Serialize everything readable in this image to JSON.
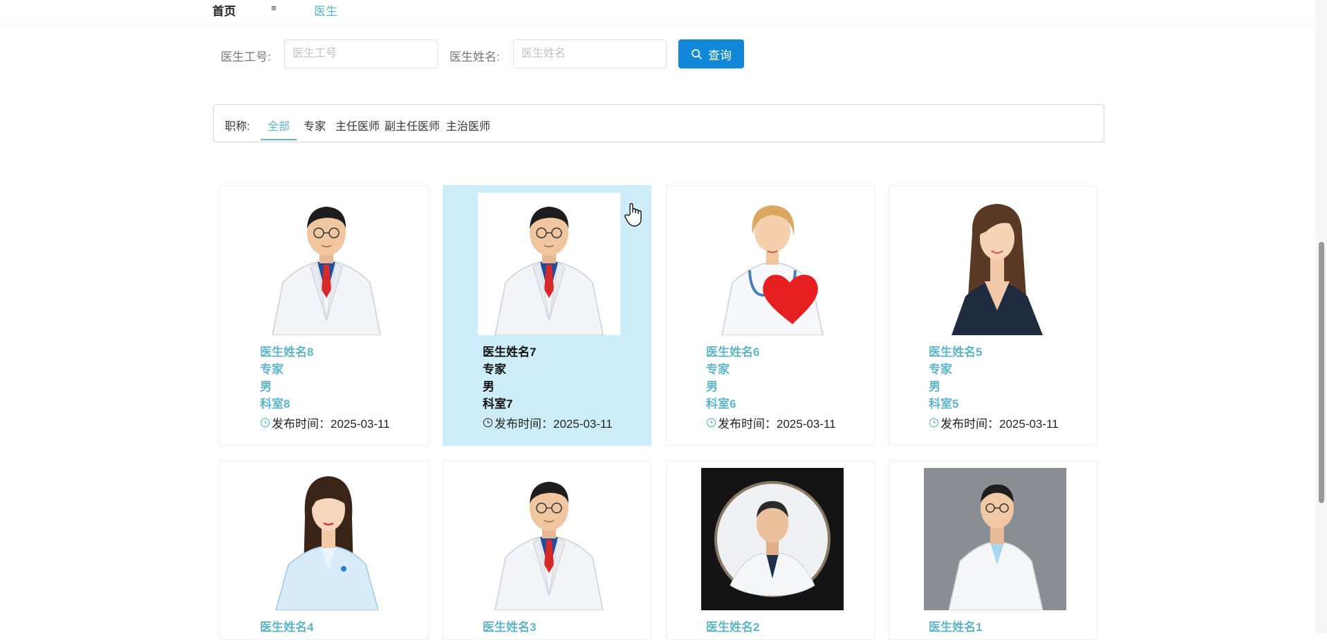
{
  "nav": {
    "home": "首页",
    "menu_glyph": "≡",
    "doctor": "医生"
  },
  "search": {
    "id_label": "医生工号:",
    "id_placeholder": "医生工号",
    "name_label": "医生姓名:",
    "name_placeholder": "医生姓名",
    "button_label": "查询"
  },
  "filter": {
    "label": "职称:",
    "options": [
      "全部",
      "专家",
      "主任医师",
      "副主任医师",
      "主治医师"
    ],
    "selected": "全部"
  },
  "colors": {
    "accent": "#5fb5c8",
    "button": "#1188d8",
    "hover_card": "#cdeef8"
  },
  "doctors": [
    {
      "name": "医生姓名8",
      "title": "专家",
      "gender": "男",
      "dept": "科室8",
      "time": "发布时间：2025-03-11"
    },
    {
      "name": "医生姓名7",
      "title": "专家",
      "gender": "男",
      "dept": "科室7",
      "time": "发布时间：2025-03-11"
    },
    {
      "name": "医生姓名6",
      "title": "专家",
      "gender": "男",
      "dept": "科室6",
      "time": "发布时间：2025-03-11"
    },
    {
      "name": "医生姓名5",
      "title": "专家",
      "gender": "男",
      "dept": "科室5",
      "time": "发布时间：2025-03-11"
    },
    {
      "name": "医生姓名4"
    },
    {
      "name": "医生姓名3"
    },
    {
      "name": "医生姓名2"
    },
    {
      "name": "医生姓名1"
    }
  ]
}
